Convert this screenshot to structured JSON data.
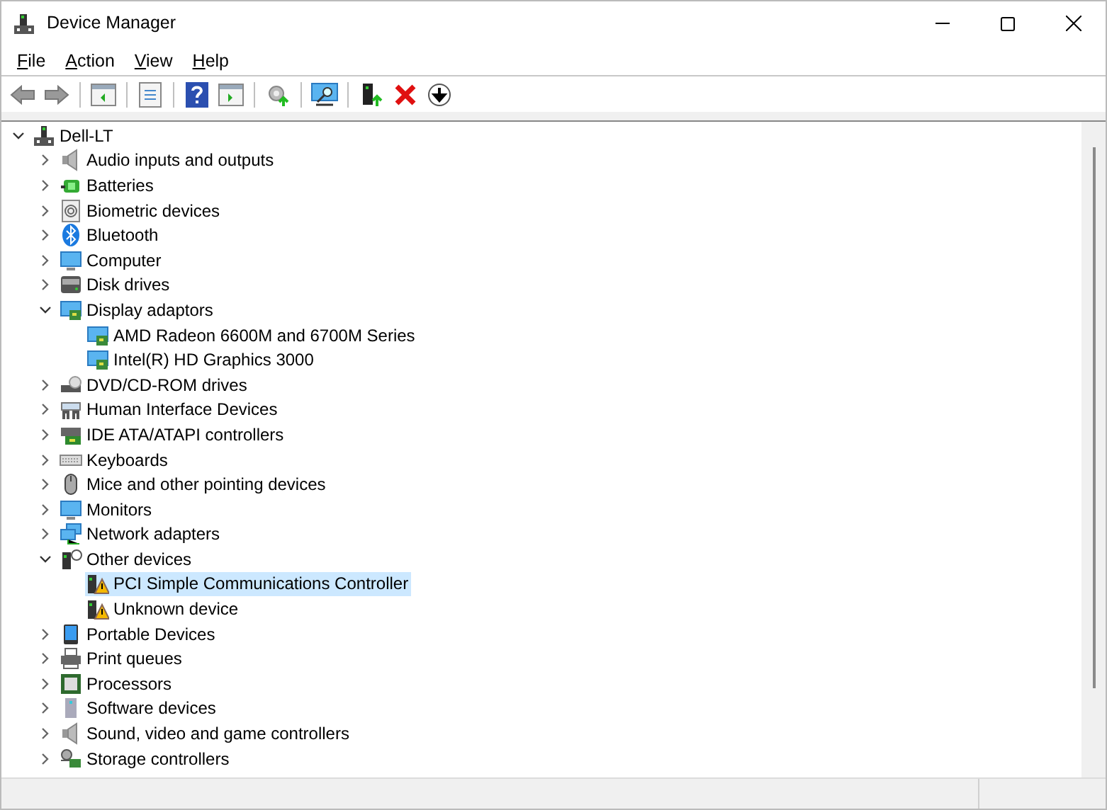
{
  "window": {
    "title": "Device Manager"
  },
  "menu": [
    {
      "label": "File"
    },
    {
      "label": "Action"
    },
    {
      "label": "View"
    },
    {
      "label": "Help"
    }
  ],
  "tree": [
    {
      "label": "Dell-LT",
      "kind": "root",
      "expanded": true,
      "selected": false,
      "children": [
        {
          "label": "Audio inputs and outputs",
          "kind": "speaker",
          "expanded": false,
          "selected": false
        },
        {
          "label": "Batteries",
          "kind": "battery",
          "expanded": false,
          "selected": false
        },
        {
          "label": "Biometric devices",
          "kind": "fingerprint",
          "expanded": false,
          "selected": false
        },
        {
          "label": "Bluetooth",
          "kind": "bluetooth",
          "expanded": false,
          "selected": false
        },
        {
          "label": "Computer",
          "kind": "monitor",
          "expanded": false,
          "selected": false
        },
        {
          "label": "Disk drives",
          "kind": "drive",
          "expanded": false,
          "selected": false
        },
        {
          "label": "Display adaptors",
          "kind": "display",
          "expanded": true,
          "selected": false,
          "children": [
            {
              "label": "AMD Radeon 6600M and 6700M Series",
              "kind": "display",
              "selected": false
            },
            {
              "label": "Intel(R) HD Graphics 3000",
              "kind": "display",
              "selected": false
            }
          ]
        },
        {
          "label": "DVD/CD-ROM drives",
          "kind": "disc",
          "expanded": false,
          "selected": false
        },
        {
          "label": "Human Interface Devices",
          "kind": "hid",
          "expanded": false,
          "selected": false
        },
        {
          "label": "IDE ATA/ATAPI controllers",
          "kind": "ide",
          "expanded": false,
          "selected": false
        },
        {
          "label": "Keyboards",
          "kind": "keyboard",
          "expanded": false,
          "selected": false
        },
        {
          "label": "Mice and other pointing devices",
          "kind": "mouse",
          "expanded": false,
          "selected": false
        },
        {
          "label": "Monitors",
          "kind": "monitor",
          "expanded": false,
          "selected": false
        },
        {
          "label": "Network adapters",
          "kind": "network",
          "expanded": false,
          "selected": false
        },
        {
          "label": "Other devices",
          "kind": "unknown",
          "expanded": true,
          "selected": false,
          "children": [
            {
              "label": "PCI Simple Communications Controller",
              "kind": "warning",
              "selected": true
            },
            {
              "label": "Unknown device",
              "kind": "warning",
              "selected": false
            }
          ]
        },
        {
          "label": "Portable Devices",
          "kind": "portable",
          "expanded": false,
          "selected": false
        },
        {
          "label": "Print queues",
          "kind": "printer",
          "expanded": false,
          "selected": false
        },
        {
          "label": "Processors",
          "kind": "chip",
          "expanded": false,
          "selected": false
        },
        {
          "label": "Software devices",
          "kind": "tower",
          "expanded": false,
          "selected": false
        },
        {
          "label": "Sound, video and game controllers",
          "kind": "speaker",
          "expanded": false,
          "selected": false
        },
        {
          "label": "Storage controllers",
          "kind": "storage",
          "expanded": false,
          "selected": false
        }
      ]
    }
  ]
}
